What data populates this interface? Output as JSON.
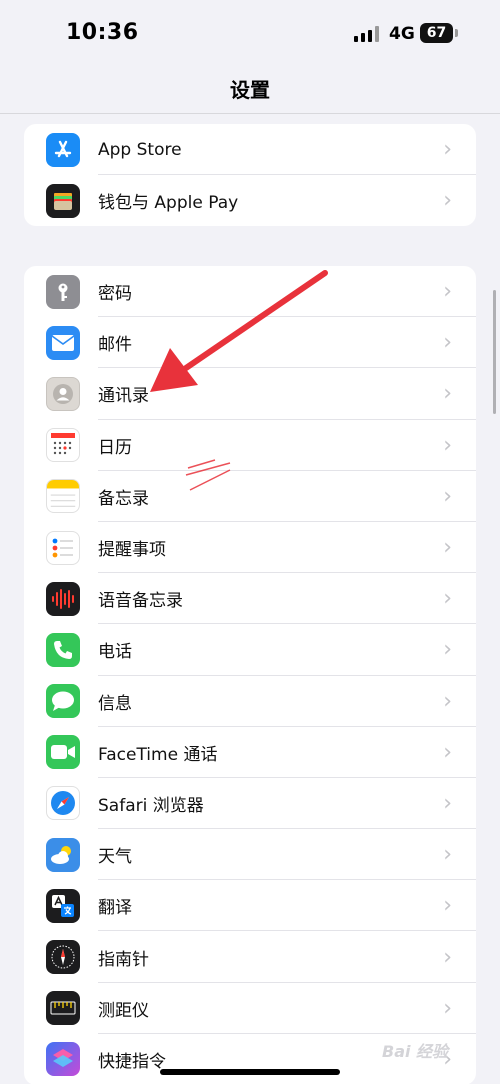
{
  "status_bar": {
    "time": "10:36",
    "network": "4G",
    "battery": "67"
  },
  "nav": {
    "title": "设置"
  },
  "groups": [
    {
      "items": [
        {
          "label": "App Store",
          "icon": "app-store-icon",
          "color": "#1a8cf6"
        },
        {
          "label": "钱包与 Apple Pay",
          "icon": "wallet-icon",
          "color": "#1c1c1e"
        }
      ]
    },
    {
      "items": [
        {
          "label": "密码",
          "icon": "key-icon",
          "color": "#8e8e93"
        },
        {
          "label": "邮件",
          "icon": "mail-icon",
          "color": "#2c8cf4"
        },
        {
          "label": "通讯录",
          "icon": "contacts-icon",
          "color": "#d9d4cf"
        },
        {
          "label": "日历",
          "icon": "calendar-icon",
          "color": "#ffffff"
        },
        {
          "label": "备忘录",
          "icon": "notes-icon",
          "color": "#ffffff"
        },
        {
          "label": "提醒事项",
          "icon": "reminders-icon",
          "color": "#ffffff"
        },
        {
          "label": "语音备忘录",
          "icon": "voice-memos-icon",
          "color": "#1c1c1e"
        },
        {
          "label": "电话",
          "icon": "phone-icon",
          "color": "#34c759"
        },
        {
          "label": "信息",
          "icon": "messages-icon",
          "color": "#34c759"
        },
        {
          "label": "FaceTime 通话",
          "icon": "facetime-icon",
          "color": "#34c759"
        },
        {
          "label": "Safari 浏览器",
          "icon": "safari-icon",
          "color": "#ffffff"
        },
        {
          "label": "天气",
          "icon": "weather-icon",
          "color": "#3b8ee8"
        },
        {
          "label": "翻译",
          "icon": "translate-icon",
          "color": "#1c1c1e"
        },
        {
          "label": "指南针",
          "icon": "compass-icon",
          "color": "#1c1c1e"
        },
        {
          "label": "测距仪",
          "icon": "measure-icon",
          "color": "#1c1c1e"
        },
        {
          "label": "快捷指令",
          "icon": "shortcuts-icon",
          "color": "#5a4fd8"
        }
      ]
    }
  ],
  "chevron": "›",
  "watermark": "Bai 经验",
  "annotation_color": "#e8323b"
}
